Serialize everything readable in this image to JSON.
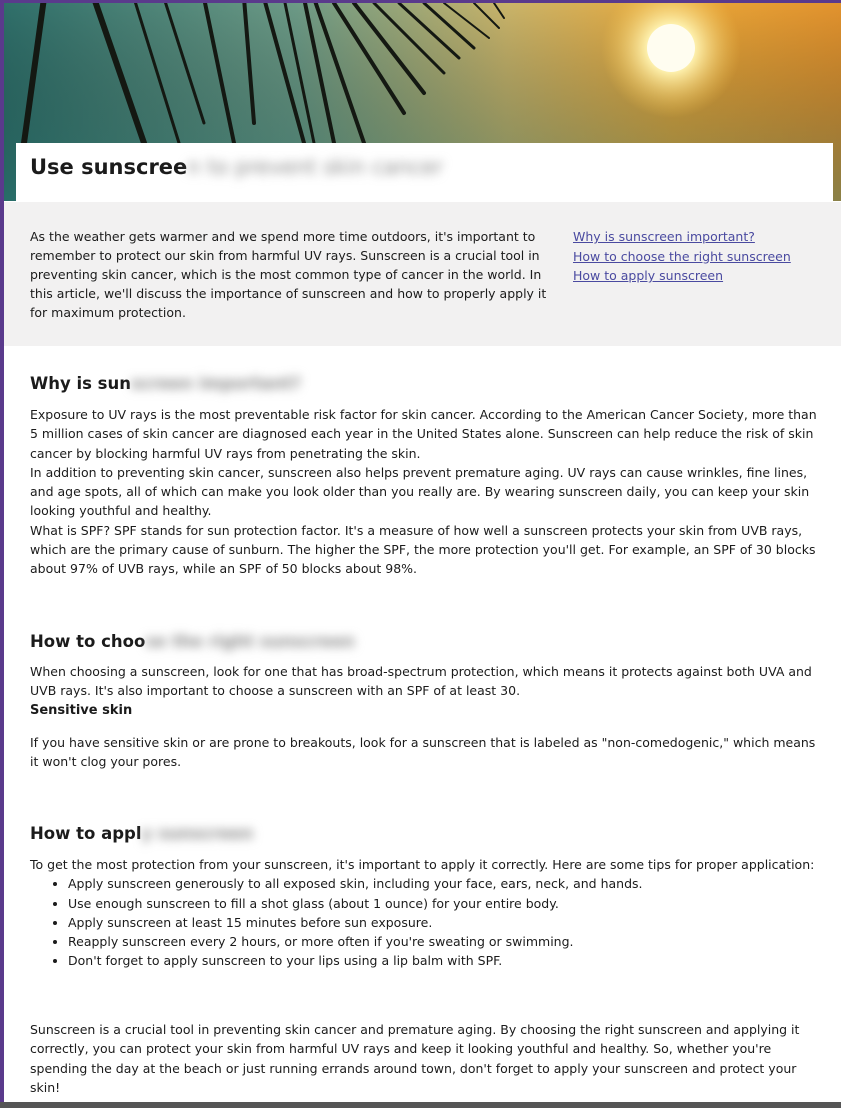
{
  "title": {
    "visible": "Use sunscree",
    "blurred": "n to prevent skin cancer"
  },
  "intro": {
    "text": "As the weather gets warmer and we spend more time outdoors, it's important to remember to protect our skin from harmful UV rays. Sunscreen is a crucial tool in preventing skin cancer, which is the most common type of cancer in the world. In this article, we'll discuss the importance of sunscreen and how to properly apply it for maximum protection.",
    "links": [
      "Why is sunscreen important?",
      "How to choose the right sunscreen",
      "How to apply sunscreen"
    ]
  },
  "sections": {
    "why": {
      "heading_visible": "Why is sun",
      "heading_blurred": "screen important?",
      "paragraphs": [
        "Exposure to UV rays is the most preventable risk factor for skin cancer. According to the American Cancer Society, more than 5 million cases of skin cancer are diagnosed each year in the United States alone. Sunscreen can help reduce the risk of skin cancer by blocking harmful UV rays from penetrating the skin.",
        "In addition to preventing skin cancer, sunscreen also helps prevent premature aging. UV rays can cause wrinkles, fine lines, and age spots, all of which can make you look older than you really are. By wearing sunscreen daily, you can keep your skin looking youthful and healthy.",
        "What is SPF? SPF stands for sun protection factor. It's a measure of how well a sunscreen protects your skin from UVB rays, which are the primary cause of sunburn. The higher the SPF, the more protection you'll get. For example, an SPF of 30 blocks about 97% of UVB rays, while an SPF of 50 blocks about 98%."
      ]
    },
    "choose": {
      "heading_visible": "How to choo",
      "heading_blurred": "se the right sunscreen",
      "paragraph": "When choosing a sunscreen, look for one that has broad-spectrum protection, which means it protects against both UVA and UVB rays. It's also important to choose a sunscreen with an SPF of at least 30.",
      "subheading": "Sensitive skin",
      "sensitive_text": "If you have sensitive skin or are prone to breakouts, look for a sunscreen that is labeled as \"non-comedogenic,\" which means it won't clog your pores."
    },
    "apply": {
      "heading_visible": "How to appl",
      "heading_blurred": "y sunscreen",
      "lead": "To get the most protection from your sunscreen, it's important to apply it correctly. Here are some tips for proper application:",
      "tips": [
        "Apply sunscreen generously to all exposed skin, including your face, ears, neck, and hands.",
        "Use enough sunscreen to fill a shot glass (about 1 ounce) for your entire body.",
        "Apply sunscreen at least 15 minutes before sun exposure.",
        "Reapply sunscreen every 2 hours, or more often if you're sweating or swimming.",
        "Don't forget to apply sunscreen to your lips using a lip balm with SPF."
      ]
    },
    "conclusion": {
      "text": "Sunscreen is a crucial tool in preventing skin cancer and premature aging. By choosing the right sunscreen and applying it correctly, you can protect your skin from harmful UV rays and keep it looking youthful and healthy. So, whether you're spending the day at the beach or just running errands around town, don't forget to apply your sunscreen and protect your skin!"
    }
  },
  "colors": {
    "link": "#4a4aa0",
    "intro_band": "#f2f1f1",
    "frame": "#5a3a8c"
  },
  "icons": [
    "palm-frond-image",
    "sun-image"
  ]
}
